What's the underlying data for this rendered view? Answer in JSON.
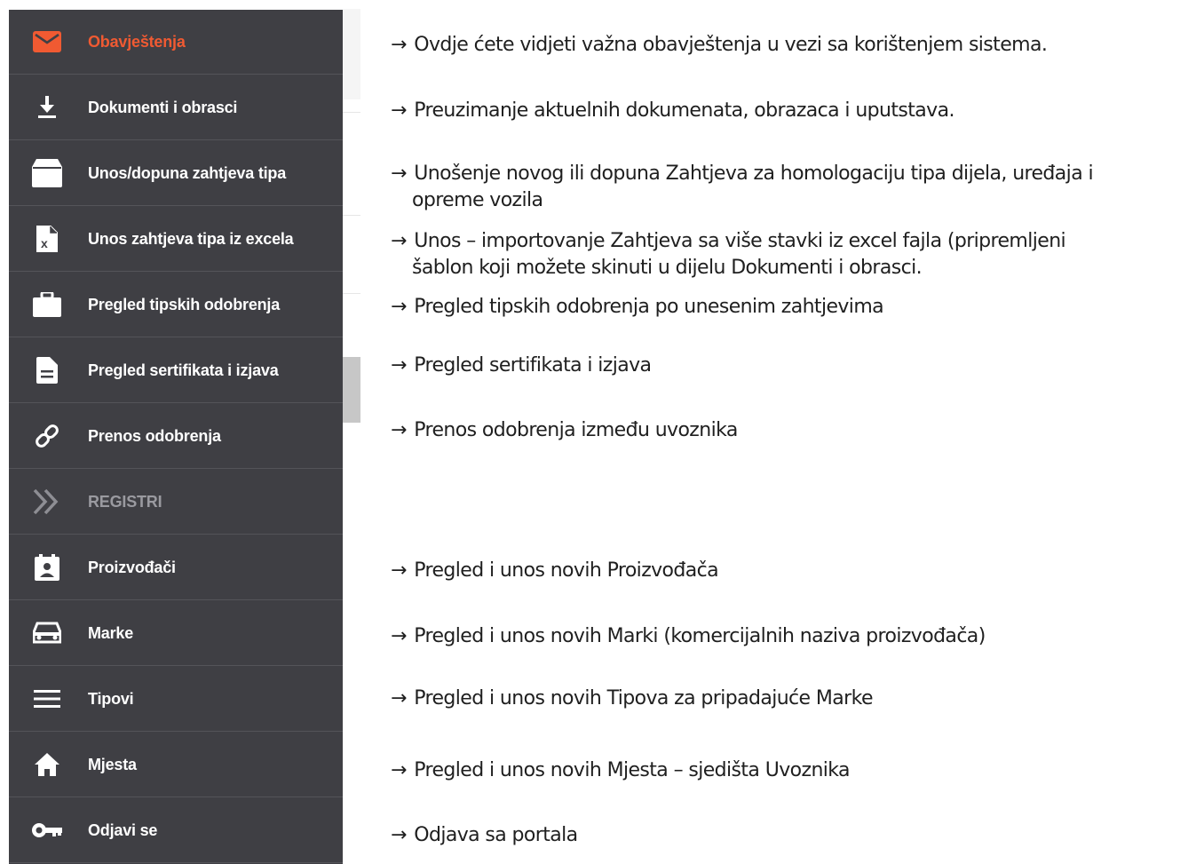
{
  "colors": {
    "sidebar_bg": "#3f3f44",
    "active": "#f05a32",
    "section": "#9a9aa0",
    "text": "#ffffff"
  },
  "arrow": "→",
  "menu": [
    {
      "label": "Obavještenja",
      "icon": "mail-icon",
      "state": "active",
      "desc": [
        "Ovdje ćete vidjeti važna obavještenja u vezi sa korištenjem sistema."
      ]
    },
    {
      "label": "Dokumenti i obrasci",
      "icon": "download-icon",
      "desc": [
        "Preuzimanje aktuelnih dokumenata, obrazaca i uputstava."
      ]
    },
    {
      "label": "Unos/dopuna zahtjeva tipa",
      "icon": "inbox-icon",
      "desc": [
        "Unošenje novog ili dopuna Zahtjeva za homologaciju tipa dijela, uređaja i",
        "opreme vozila"
      ]
    },
    {
      "label": "Unos zahtjeva tipa iz excela",
      "icon": "excel-icon",
      "desc": [
        "Unos – importovanje Zahtjeva sa više stavki iz excel fajla (pripremljeni",
        "šablon koji možete skinuti u dijelu Dokumenti i obrasci."
      ]
    },
    {
      "label": "Pregled tipskih odobrenja",
      "icon": "briefcase-icon",
      "desc": [
        "Pregled tipskih odobrenja po unesenim zahtjevima"
      ]
    },
    {
      "label": "Pregled sertifikata i izjava",
      "icon": "document-icon",
      "desc": [
        "Pregled sertifikata i izjava"
      ]
    },
    {
      "label": "Prenos odobrenja",
      "icon": "link-icon",
      "desc": [
        "Prenos odobrenja između uvoznika"
      ]
    },
    {
      "label": "REGISTRI",
      "icon": "double-chevron-icon",
      "state": "section",
      "desc": []
    },
    {
      "label": "Proizvođači",
      "icon": "contact-icon",
      "desc": [
        "Pregled i unos novih Proizvođača"
      ]
    },
    {
      "label": "Marke",
      "icon": "car-icon",
      "desc": [
        "Pregled i unos novih Marki (komercijalnih naziva proizvođača)"
      ]
    },
    {
      "label": "Tipovi",
      "icon": "menu-icon",
      "desc": [
        "Pregled i unos novih Tipova za pripadajuće Marke"
      ]
    },
    {
      "label": "Mjesta",
      "icon": "home-icon",
      "desc": [
        "Pregled i unos novih Mjesta – sjedišta Uvoznika"
      ]
    },
    {
      "label": "Odjavi se",
      "icon": "key-icon",
      "desc": [
        "Odjava sa portala"
      ]
    }
  ]
}
